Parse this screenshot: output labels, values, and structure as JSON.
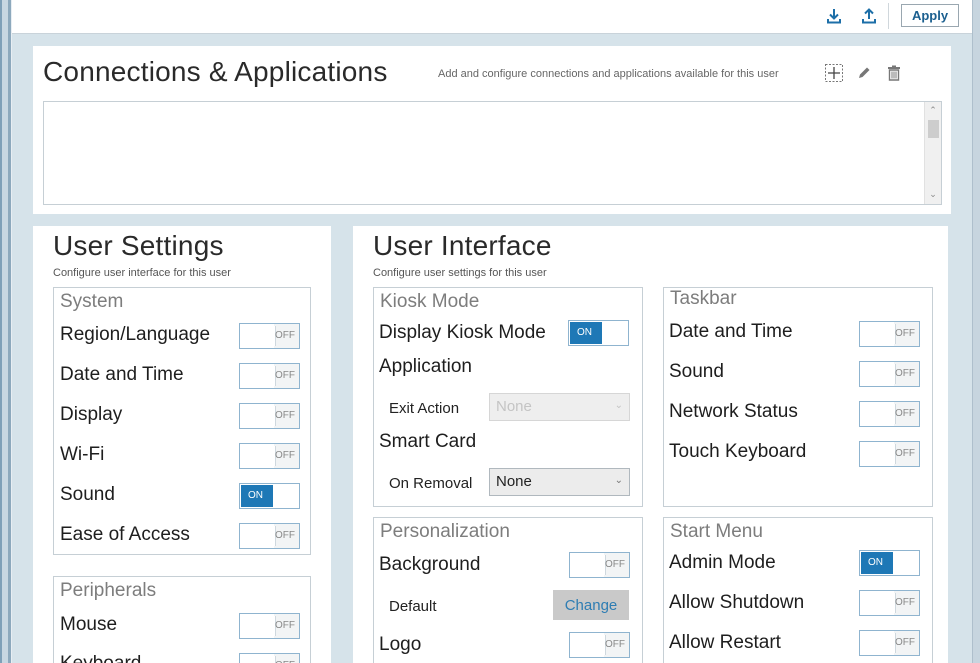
{
  "toolbar": {
    "download_icon": "download-icon",
    "upload_icon": "upload-icon",
    "apply_label": "Apply",
    "accent": "#1b5f8f"
  },
  "connections": {
    "title": "Connections & Applications",
    "description": "Add and configure connections and applications available for this user",
    "icons": [
      "add-icon",
      "edit-icon",
      "delete-icon"
    ]
  },
  "user_settings": {
    "title": "User Settings",
    "subtitle": "Configure user interface for this user",
    "system": {
      "title": "System",
      "items": [
        {
          "label": "Region/Language",
          "state": "OFF"
        },
        {
          "label": "Date and Time",
          "state": "OFF"
        },
        {
          "label": "Display",
          "state": "OFF"
        },
        {
          "label": "Wi-Fi",
          "state": "OFF"
        },
        {
          "label": "Sound",
          "state": "ON"
        },
        {
          "label": "Ease of Access",
          "state": "OFF"
        }
      ]
    },
    "peripherals": {
      "title": "Peripherals",
      "items": [
        {
          "label": "Mouse",
          "state": "OFF"
        },
        {
          "label": "Keyboard",
          "state": "OFF"
        }
      ]
    }
  },
  "user_interface": {
    "title": "User Interface",
    "subtitle": "Configure user settings for this user",
    "kiosk": {
      "title": "Kiosk Mode",
      "display_kiosk_label": "Display Kiosk Mode",
      "display_kiosk_state": "ON",
      "application_label": "Application",
      "exit_action_label": "Exit Action",
      "exit_action_value": "None",
      "smart_card_label": "Smart Card",
      "on_removal_label": "On Removal",
      "on_removal_value": "None"
    },
    "taskbar": {
      "title": "Taskbar",
      "items": [
        {
          "label": "Date and Time",
          "state": "OFF"
        },
        {
          "label": "Sound",
          "state": "OFF"
        },
        {
          "label": "Network Status",
          "state": "OFF"
        },
        {
          "label": "Touch Keyboard",
          "state": "OFF"
        }
      ]
    },
    "personalization": {
      "title": "Personalization",
      "background_label": "Background",
      "background_state": "OFF",
      "default_label": "Default",
      "change_label": "Change",
      "logo_label": "Logo",
      "logo_state": "OFF"
    },
    "start_menu": {
      "title": "Start Menu",
      "items": [
        {
          "label": "Admin Mode",
          "state": "ON"
        },
        {
          "label": "Allow Shutdown",
          "state": "OFF"
        },
        {
          "label": "Allow Restart",
          "state": "OFF"
        }
      ]
    }
  }
}
